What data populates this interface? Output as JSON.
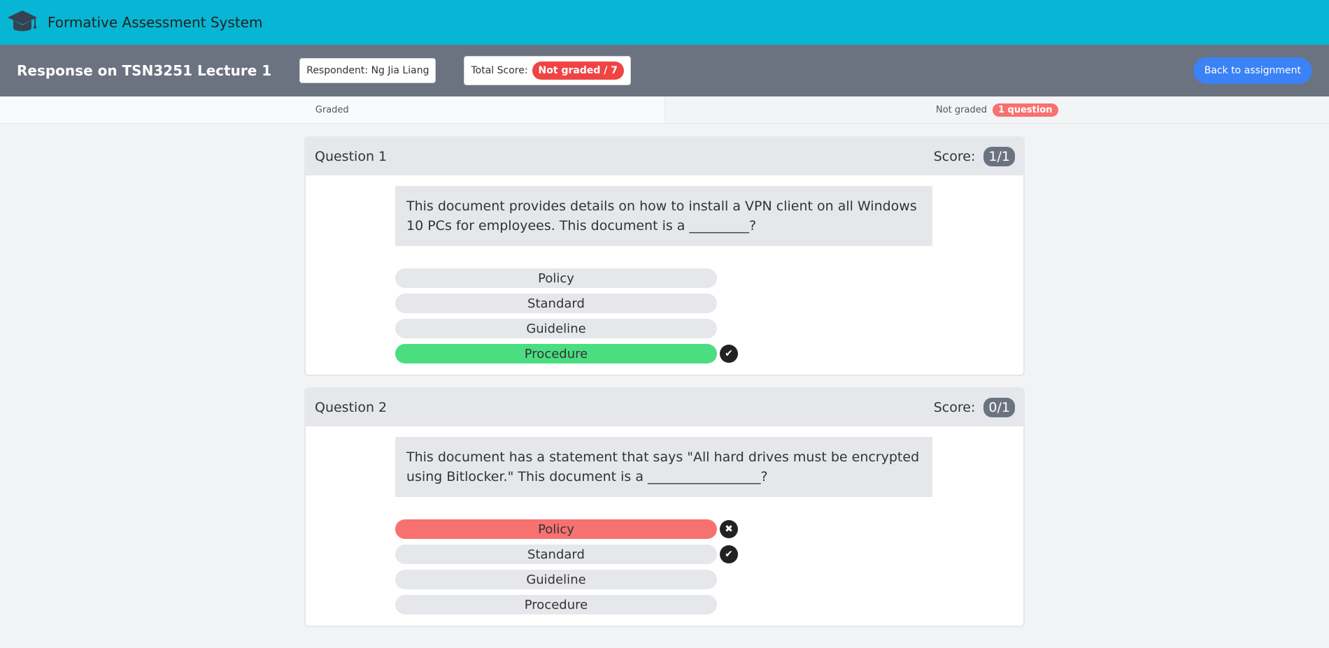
{
  "app": {
    "title": "Formative Assessment System",
    "logo_icon": "graduation-cap-icon"
  },
  "header": {
    "title": "Response on TSN3251 Lecture 1",
    "respondent": "Respondent: Ng Jia Liang",
    "total_score_label": "Total Score:",
    "total_score_value": "Not graded / 7",
    "back_button": "Back to assignment"
  },
  "tabs": {
    "graded": "Graded",
    "not_graded": "Not graded",
    "not_graded_badge": "1 question"
  },
  "questions": [
    {
      "title": "Question 1",
      "score_label": "Score:",
      "score": "1/1",
      "prompt": "This document provides details on how to install a VPN client on all Windows 10 PCs for employees. This document is a _________?",
      "options": [
        {
          "label": "Policy",
          "state": "none",
          "mark": ""
        },
        {
          "label": "Standard",
          "state": "none",
          "mark": ""
        },
        {
          "label": "Guideline",
          "state": "none",
          "mark": ""
        },
        {
          "label": "Procedure",
          "state": "correct",
          "mark": "check-icon"
        }
      ]
    },
    {
      "title": "Question 2",
      "score_label": "Score:",
      "score": "0/1",
      "prompt": "This document has a statement that says \"All hard drives must be encrypted using Bitlocker.\" This document is a _________________?",
      "options": [
        {
          "label": "Policy",
          "state": "wrong",
          "mark": "cross-icon"
        },
        {
          "label": "Standard",
          "state": "none",
          "mark": "check-icon"
        },
        {
          "label": "Guideline",
          "state": "none",
          "mark": ""
        },
        {
          "label": "Procedure",
          "state": "none",
          "mark": ""
        }
      ]
    }
  ],
  "colors": {
    "topbar": "#06b6d4",
    "subheader": "#6b7280",
    "correct": "#4ade80",
    "wrong": "#f87171",
    "accent": "#3b82f6"
  }
}
